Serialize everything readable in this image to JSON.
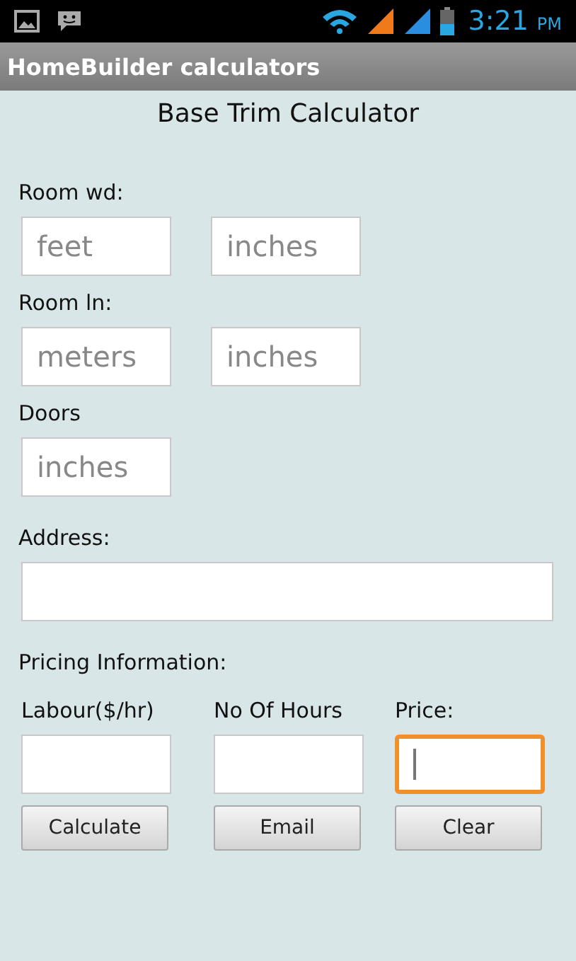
{
  "status_bar": {
    "time": "3:21",
    "meridiem": "PM"
  },
  "app_bar": {
    "title": "HomeBuilder calculators"
  },
  "heading": "Base Trim Calculator",
  "groups": [
    {
      "label": "Room wd:",
      "fields": [
        {
          "placeholder": "feet",
          "focused": false
        },
        {
          "placeholder": "inches",
          "focused": false
        }
      ]
    },
    {
      "label": "Room ln:",
      "fields": [
        {
          "placeholder": "meters",
          "focused": false
        },
        {
          "placeholder": "inches",
          "focused": false
        }
      ]
    },
    {
      "label": "Doors",
      "fields": [
        {
          "placeholder": "inches",
          "focused": false
        }
      ]
    }
  ],
  "address": {
    "label": "Address:",
    "focused": false
  },
  "pricing": {
    "label": "Pricing Information:",
    "columns": [
      {
        "label": "Labour($/hr)",
        "focused": false
      },
      {
        "label": "No Of Hours",
        "focused": false
      },
      {
        "label": "Price:",
        "focused": true
      }
    ]
  },
  "buttons": [
    "Calculate",
    "Email",
    "Clear"
  ]
}
